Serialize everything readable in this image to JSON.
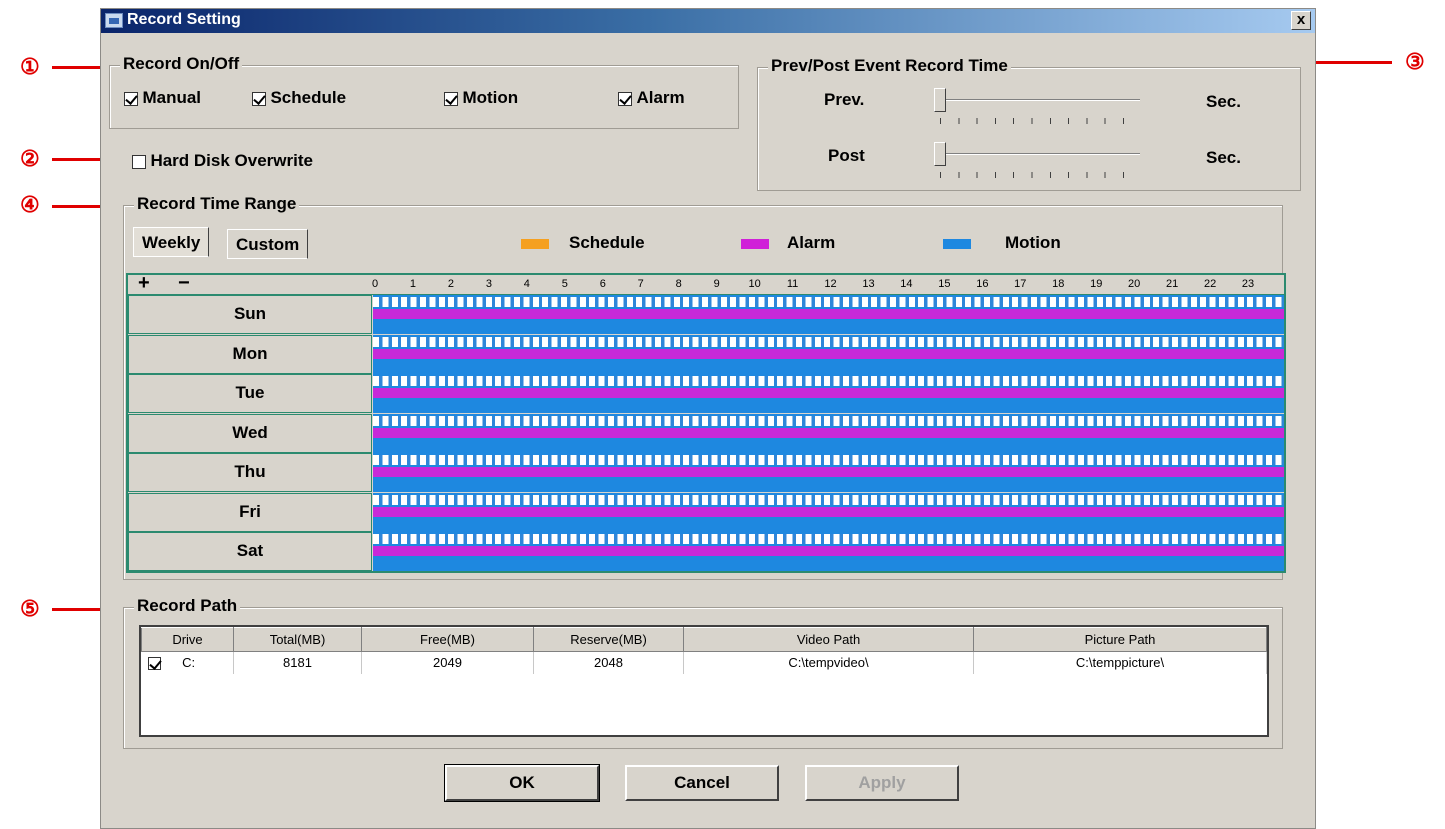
{
  "window": {
    "title": "Record Setting",
    "close_label": "x"
  },
  "record_on_off": {
    "title": "Record On/Off",
    "options": [
      {
        "label": "Manual",
        "checked": true
      },
      {
        "label": "Schedule",
        "checked": true
      },
      {
        "label": "Motion",
        "checked": true
      },
      {
        "label": "Alarm",
        "checked": true
      }
    ]
  },
  "hard_disk_overwrite": {
    "label": "Hard Disk Overwrite",
    "checked": false
  },
  "event_time": {
    "title": "Prev/Post Event Record Time",
    "prev": {
      "label": "Prev.",
      "unit": "Sec.",
      "value": 0
    },
    "post": {
      "label": "Post",
      "unit": "Sec.",
      "value": 0
    }
  },
  "time_range": {
    "title": "Record Time Range",
    "tabs": [
      "Weekly",
      "Custom"
    ],
    "active_tab": "Weekly",
    "legend": [
      {
        "label": "Schedule",
        "color": "#f5a020"
      },
      {
        "label": "Alarm",
        "color": "#d020d8"
      },
      {
        "label": "Motion",
        "color": "#1e88e0"
      }
    ],
    "zoom": [
      "+",
      "−"
    ],
    "hours": [
      "0",
      "1",
      "2",
      "3",
      "4",
      "5",
      "6",
      "7",
      "8",
      "9",
      "10",
      "11",
      "12",
      "13",
      "14",
      "15",
      "16",
      "17",
      "18",
      "19",
      "20",
      "21",
      "22",
      "23"
    ],
    "days": [
      "Sun",
      "Mon",
      "Tue",
      "Wed",
      "Thu",
      "Fri",
      "Sat"
    ]
  },
  "record_path": {
    "title": "Record Path",
    "columns": [
      "Drive",
      "Total(MB)",
      "Free(MB)",
      "Reserve(MB)",
      "Video Path",
      "Picture Path"
    ],
    "rows": [
      {
        "checked": true,
        "drive": "C:",
        "total": "8181",
        "free": "2049",
        "reserve": "2048",
        "video_path": "C:\\tempvideo\\",
        "picture_path": "C:\\temppicture\\"
      }
    ]
  },
  "buttons": {
    "ok": "OK",
    "cancel": "Cancel",
    "apply": "Apply"
  },
  "callouts": [
    "①",
    "②",
    "③",
    "④",
    "⑤"
  ],
  "colors": {
    "accent_red": "#e00000",
    "title_blue": "#0a246a"
  }
}
